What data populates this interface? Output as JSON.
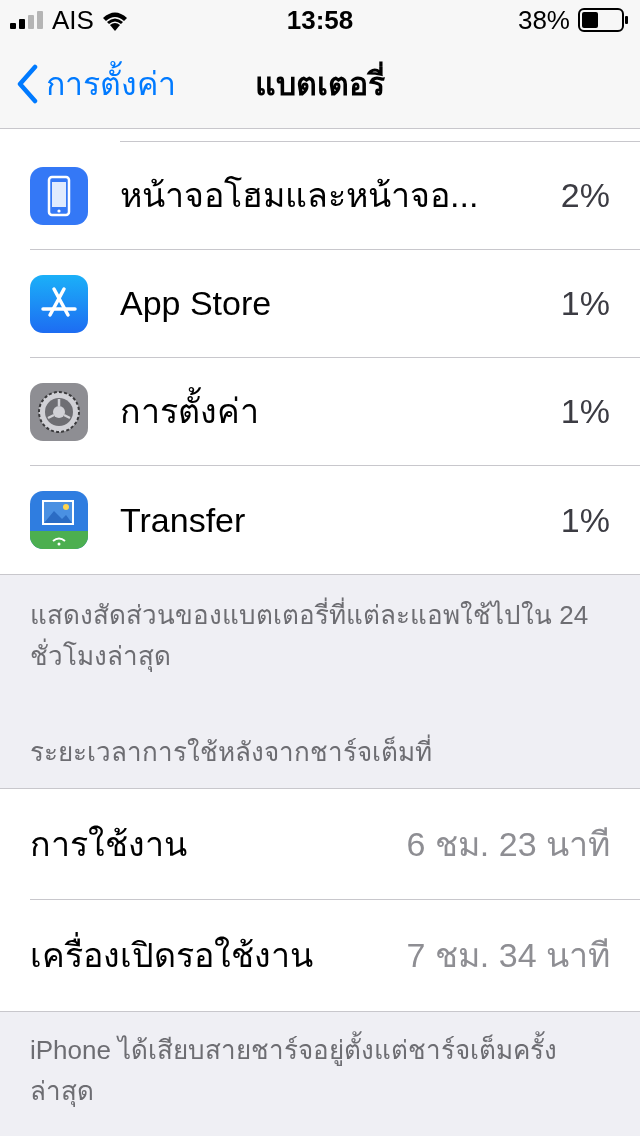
{
  "status_bar": {
    "carrier": "AIS",
    "time": "13:58",
    "battery": "38%"
  },
  "nav": {
    "back": "การตั้งค่า",
    "title": "แบตเตอรี่"
  },
  "apps": [
    {
      "kind": "home_screen",
      "name": "หน้าจอโฮมและหน้าจอ...",
      "percent": "2%"
    },
    {
      "kind": "app_store",
      "name": "App Store",
      "percent": "1%"
    },
    {
      "kind": "settings",
      "name": "การตั้งค่า",
      "percent": "1%"
    },
    {
      "kind": "transfer",
      "name": "Transfer",
      "percent": "1%"
    }
  ],
  "apps_note": "แสดงสัดส่วนของแบตเตอรี่ที่แต่ละแอพใช้ไปใน 24 ชั่วโมงล่าสุด",
  "section_header": "ระยะเวลาการใช้หลังจากชาร์จเต็มที่",
  "usage_rows": [
    {
      "label": "การใช้งาน",
      "value": "6 ชม. 23 นาที"
    },
    {
      "label": "เครื่องเปิดรอใช้งาน",
      "value": "7 ชม. 34 นาที"
    }
  ],
  "footer_note": "iPhone ได้เสียบสายชาร์จอยู่ตั้งแต่ชาร์จเต็มครั้งล่าสุด"
}
